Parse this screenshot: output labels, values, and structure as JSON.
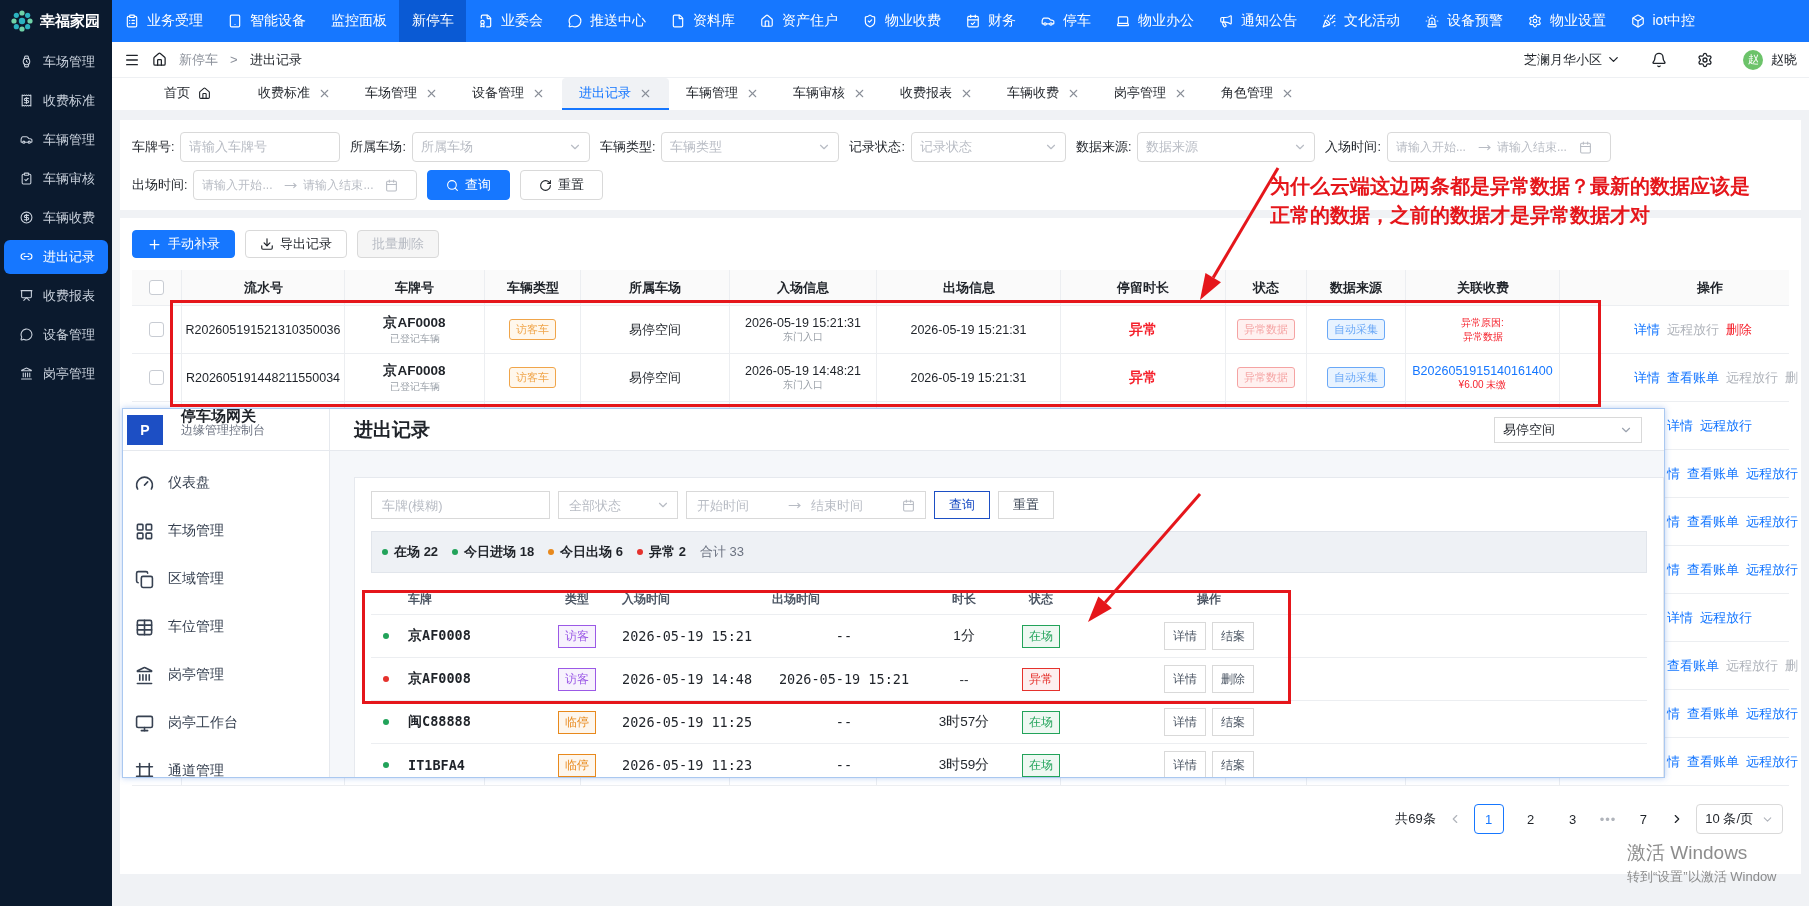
{
  "app": {
    "logo_text": "幸福家园"
  },
  "sidebar": {
    "items": [
      {
        "label": "车场管理",
        "selected": false
      },
      {
        "label": "收费标准",
        "selected": false
      },
      {
        "label": "车辆管理",
        "selected": false
      },
      {
        "label": "车辆审核",
        "selected": false
      },
      {
        "label": "车辆收费",
        "selected": false
      },
      {
        "label": "进出记录",
        "selected": true
      },
      {
        "label": "收费报表",
        "selected": false
      },
      {
        "label": "设备管理",
        "selected": false
      },
      {
        "label": "岗亭管理",
        "selected": false
      }
    ]
  },
  "top_nav": [
    {
      "label": "业务受理",
      "selected": false
    },
    {
      "label": "智能设备",
      "selected": false
    },
    {
      "label": "监控面板",
      "selected": false
    },
    {
      "label": "新停车",
      "selected": true
    },
    {
      "label": "业委会",
      "selected": false
    },
    {
      "label": "推送中心",
      "selected": false
    },
    {
      "label": "资料库",
      "selected": false
    },
    {
      "label": "资产住户",
      "selected": false
    },
    {
      "label": "物业收费",
      "selected": false
    },
    {
      "label": "财务",
      "selected": false
    },
    {
      "label": "停车",
      "selected": false
    },
    {
      "label": "物业办公",
      "selected": false
    },
    {
      "label": "通知公告",
      "selected": false
    },
    {
      "label": "文化活动",
      "selected": false
    },
    {
      "label": "设备预警",
      "selected": false
    },
    {
      "label": "物业设置",
      "selected": false
    },
    {
      "label": "iot中控",
      "selected": false
    }
  ],
  "breadcrumb": {
    "items": [
      "新停车",
      "进出记录"
    ],
    "separator": ">"
  },
  "header_right": {
    "community": "芝澜月华小区",
    "avatar": "赵",
    "user": "赵晓"
  },
  "tabs": [
    {
      "label": "首页",
      "selected": false,
      "kind": "home"
    },
    {
      "label": "收费标准",
      "selected": false,
      "kind": "closable"
    },
    {
      "label": "车场管理",
      "selected": false,
      "kind": "closable"
    },
    {
      "label": "设备管理",
      "selected": false,
      "kind": "closable"
    },
    {
      "label": "进出记录",
      "selected": true,
      "kind": "closable"
    },
    {
      "label": "车辆管理",
      "selected": false,
      "kind": "closable"
    },
    {
      "label": "车辆审核",
      "selected": false,
      "kind": "closable"
    },
    {
      "label": "收费报表",
      "selected": false,
      "kind": "closable"
    },
    {
      "label": "车辆收费",
      "selected": false,
      "kind": "closable"
    },
    {
      "label": "岗亭管理",
      "selected": false,
      "kind": "closable"
    },
    {
      "label": "角色管理",
      "selected": false,
      "kind": "closable"
    }
  ],
  "filters": [
    {
      "label": "车牌号:",
      "kind": "input",
      "placeholder": "请输入车牌号"
    },
    {
      "label": "所属车场:",
      "kind": "select",
      "placeholder": "所属车场"
    },
    {
      "label": "车辆类型:",
      "kind": "select",
      "placeholder": "车辆类型"
    },
    {
      "label": "记录状态:",
      "kind": "select",
      "placeholder": "记录状态"
    },
    {
      "label": "数据来源:",
      "kind": "select",
      "placeholder": "数据来源"
    },
    {
      "label": "入场时间:",
      "kind": "range",
      "start_placeholder": "请输入开始...",
      "end_placeholder": "请输入结束..."
    },
    {
      "label": "出场时间:",
      "kind": "range",
      "start_placeholder": "请输入开始...",
      "end_placeholder": "请输入结束..."
    }
  ],
  "filter_buttons": [
    {
      "label": "查询",
      "kind": "primary"
    },
    {
      "label": "重置",
      "kind": "default"
    }
  ],
  "toolbar": [
    {
      "label": "手动补录",
      "kind": "primary",
      "disabled": false
    },
    {
      "label": "导出记录",
      "kind": "default",
      "disabled": false
    },
    {
      "label": "批量删除",
      "kind": "default",
      "disabled": true
    }
  ],
  "table": {
    "select_all_checked": false,
    "columns": [
      "流水号",
      "车牌号",
      "车辆类型",
      "所属车场",
      "入场信息",
      "出场信息",
      "停留时长",
      "状态",
      "数据来源",
      "关联收费",
      "操作"
    ],
    "rows": [
      {
        "checked": false,
        "serial": "R202605191521310350036",
        "plate": "京AF0008",
        "plate_note": "已登记车辆",
        "type": "访客车",
        "lot": "易停空间",
        "entry_time": "2026-05-19 15:21:31",
        "entry_gate": "东门入口",
        "exit_time": "2026-05-19 15:21:31",
        "duration": "异常",
        "status": "异常数据",
        "source": "自动采集",
        "fee": {
          "kind": "reason",
          "lines": [
            "异常原因:",
            "异常数据"
          ]
        },
        "actions": [
          {
            "label": "详情",
            "kind": "link"
          },
          {
            "label": "远程放行",
            "kind": "muted"
          },
          {
            "label": "删除",
            "kind": "danger"
          }
        ]
      },
      {
        "checked": false,
        "serial": "R202605191448211550034",
        "plate": "京AF0008",
        "plate_note": "已登记车辆",
        "type": "访客车",
        "lot": "易停空间",
        "entry_time": "2026-05-19 14:48:21",
        "entry_gate": "东门入口",
        "exit_time": "2026-05-19 15:21:31",
        "duration": "异常",
        "status": "异常数据",
        "source": "自动采集",
        "fee": {
          "kind": "bill",
          "bill_no": "B2026051915140161400",
          "amount": "¥6.00 未缴"
        },
        "actions": [
          {
            "label": "详情",
            "kind": "link"
          },
          {
            "label": "查看账单",
            "kind": "link"
          },
          {
            "label": "远程放行",
            "kind": "muted"
          },
          {
            "label": "删",
            "kind": "muted"
          }
        ]
      },
      {
        "actions": [
          {
            "label": "详情",
            "kind": "link"
          },
          {
            "label": "远程放行",
            "kind": "link"
          }
        ]
      },
      {
        "actions": [
          {
            "label": "情",
            "kind": "link"
          },
          {
            "label": "查看账单",
            "kind": "link"
          },
          {
            "label": "远程放行",
            "kind": "link"
          }
        ]
      },
      {
        "actions": [
          {
            "label": "情",
            "kind": "link"
          },
          {
            "label": "查看账单",
            "kind": "link"
          },
          {
            "label": "远程放行",
            "kind": "link"
          }
        ]
      },
      {
        "actions": [
          {
            "label": "情",
            "kind": "link"
          },
          {
            "label": "查看账单",
            "kind": "link"
          },
          {
            "label": "远程放行",
            "kind": "link"
          }
        ]
      },
      {
        "actions": [
          {
            "label": "详情",
            "kind": "link"
          },
          {
            "label": "远程放行",
            "kind": "link"
          }
        ]
      },
      {
        "actions": [
          {
            "label": "查看账单",
            "kind": "link"
          },
          {
            "label": "远程放行",
            "kind": "muted"
          },
          {
            "label": "删",
            "kind": "muted"
          }
        ]
      },
      {
        "actions": [
          {
            "label": "情",
            "kind": "link"
          },
          {
            "label": "查看账单",
            "kind": "link"
          },
          {
            "label": "远程放行",
            "kind": "link"
          }
        ]
      },
      {
        "actions": [
          {
            "label": "情",
            "kind": "link"
          },
          {
            "label": "查看账单",
            "kind": "link"
          },
          {
            "label": "远程放行",
            "kind": "link"
          }
        ]
      }
    ]
  },
  "pagination": {
    "total": "共69条",
    "pages": [
      {
        "label": "1",
        "selected": true
      },
      {
        "label": "2",
        "selected": false
      },
      {
        "label": "3",
        "selected": false
      }
    ],
    "ellipsis": "•••",
    "last": "7",
    "page_size": "10 条/页"
  },
  "gateway_window": {
    "logo": "P",
    "title": "停车场网关",
    "subtitle": "边缘管理控制台",
    "menu": [
      "仪表盘",
      "车场管理",
      "区域管理",
      "车位管理",
      "岗亭管理",
      "岗亭工作台",
      "通道管理"
    ],
    "page_title": "进出记录",
    "lot_select": "易停空间",
    "filters": {
      "plate_placeholder": "车牌(模糊)",
      "status_placeholder": "全部状态",
      "start_placeholder": "开始时间",
      "end_placeholder": "结束时间"
    },
    "buttons": [
      {
        "label": "查询",
        "kind": "primary"
      },
      {
        "label": "重置",
        "kind": "default"
      }
    ],
    "summary": [
      {
        "label": "在场",
        "count": "22",
        "color": "#22a35a"
      },
      {
        "label": "今日进场",
        "count": "18",
        "color": "#22a35a"
      },
      {
        "label": "今日出场",
        "count": "6",
        "color": "#e8891c"
      },
      {
        "label": "异常",
        "count": "2",
        "color": "#e5322d"
      }
    ],
    "total": {
      "label": "合计",
      "count": "33"
    },
    "columns": [
      "车牌",
      "类型",
      "入场时间",
      "出场时间",
      "时长",
      "状态",
      "操作"
    ],
    "rows": [
      {
        "color": "#22a35a",
        "plate": "京AF0008",
        "type": {
          "label": "访客",
          "color": "#9b59e6"
        },
        "entry": "2026-05-19 15:21",
        "exit": "--",
        "duration": "1分",
        "status": {
          "label": "在场",
          "color": "#22a35a"
        },
        "actions": [
          "详情",
          "结案"
        ]
      },
      {
        "color": "#e5322d",
        "plate": "京AF0008",
        "type": {
          "label": "访客",
          "color": "#9b59e6"
        },
        "entry": "2026-05-19 14:48",
        "exit": "2026-05-19 15:21",
        "duration": "--",
        "status": {
          "label": "异常",
          "color": "#e5322d"
        },
        "actions": [
          "详情",
          "删除"
        ]
      },
      {
        "color": "#22a35a",
        "plate": "闽C88888",
        "type": {
          "label": "临停",
          "color": "#e8891c"
        },
        "entry": "2026-05-19 11:25",
        "exit": "--",
        "duration": "3时57分",
        "status": {
          "label": "在场",
          "color": "#22a35a"
        },
        "actions": [
          "详情",
          "结案"
        ]
      },
      {
        "color": "#22a35a",
        "plate": "IT1BFA4",
        "type": {
          "label": "临停",
          "color": "#e8891c"
        },
        "entry": "2026-05-19 11:23",
        "exit": "--",
        "duration": "3时59分",
        "status": {
          "label": "在场",
          "color": "#22a35a"
        },
        "actions": [
          "详情",
          "结案"
        ]
      }
    ]
  },
  "annotation": {
    "note": "为什么云端这边两条都是异常数据？最新的数据应该是正常的数据，之前的数据才是异常数据才对"
  },
  "os_notice": {
    "title": "激活 Windows",
    "hint": "转到“设置”以激活 Window"
  }
}
